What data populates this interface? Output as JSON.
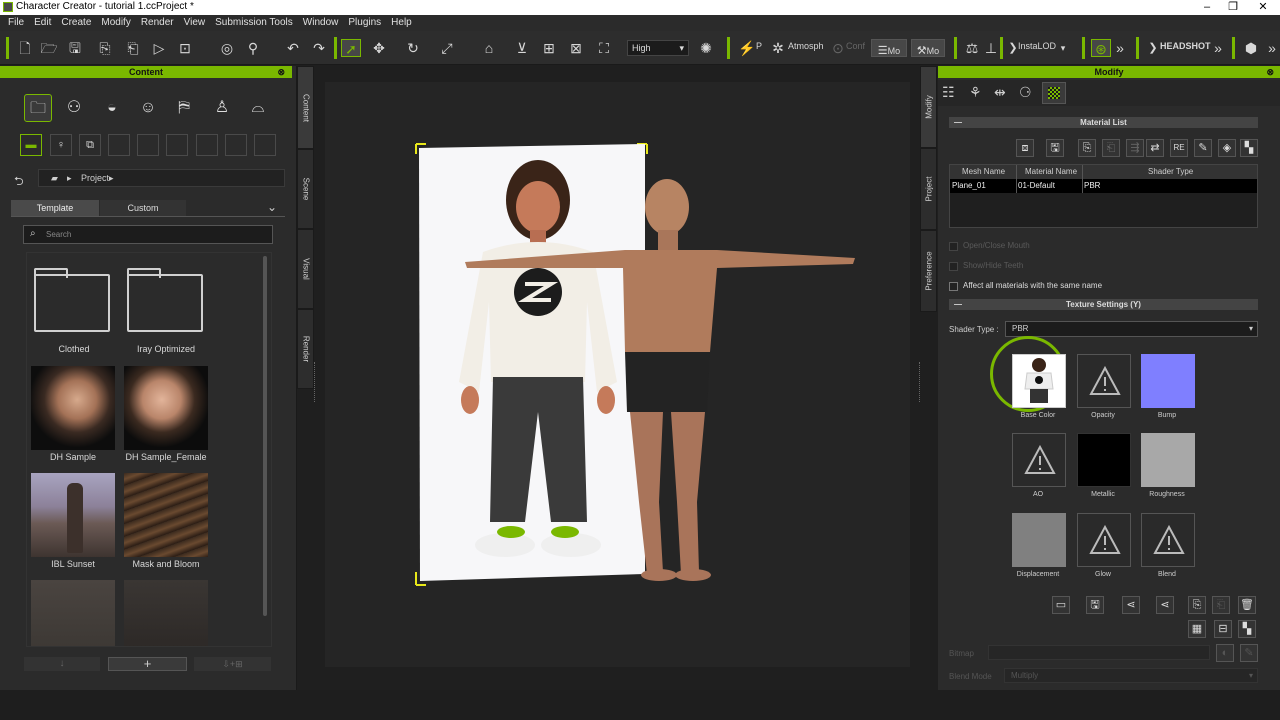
{
  "window": {
    "title": "Character Creator - tutorial 1.ccProject *"
  },
  "menu": [
    "File",
    "Edit",
    "Create",
    "Modify",
    "Render",
    "View",
    "Submission Tools",
    "Window",
    "Plugins",
    "Help"
  ],
  "toolbar": {
    "quality": "High",
    "p_label": "P",
    "atmos_label": "Atmosph",
    "conf_label": "Conf",
    "mo_label": "Mo",
    "instalod_label": "InstaLOD",
    "headshot_label": "HEADSHOT"
  },
  "content_panel": {
    "title": "Content",
    "breadcrumb": "Project",
    "tabs": [
      "Template",
      "Custom"
    ],
    "search_placeholder": "Search",
    "items": [
      "Clothed",
      "Iray Optimized",
      "DH Sample",
      "DH Sample_Female",
      "IBL Sunset",
      "Mask and Bloom"
    ]
  },
  "side_tabs_left": [
    "Content",
    "Scene",
    "Visual",
    "Render"
  ],
  "side_tabs_right": [
    "Modify",
    "Project",
    "Preference"
  ],
  "modify_panel": {
    "title": "Modify",
    "material_list_title": "Material List",
    "columns": [
      "Mesh Name",
      "Material Name",
      "Shader Type"
    ],
    "rows": [
      {
        "mesh": "Plane_01",
        "material": "01-Default",
        "shader": "PBR"
      }
    ],
    "open_close_mouth": "Open/Close Mouth",
    "show_hide_teeth": "Show/Hide Teeth",
    "affect_all": "Affect all materials with the same name",
    "texture_settings_title": "Texture Settings  (Y)",
    "shader_type_label": "Shader Type :",
    "shader_type_value": "PBR",
    "textures": [
      "Base Color",
      "Opacity",
      "Bump",
      "AO",
      "Metallic",
      "Roughness",
      "Displacement",
      "Glow",
      "Blend"
    ],
    "bitmap_label": "Bitmap",
    "blend_mode_label": "Blend Mode",
    "blend_mode_value": "Multiply"
  },
  "colors": {
    "accent": "#7ab800",
    "bump": "#7f7fff",
    "metallic": "#000000",
    "roughness": "#a8a8a8",
    "displacement": "#808080"
  }
}
